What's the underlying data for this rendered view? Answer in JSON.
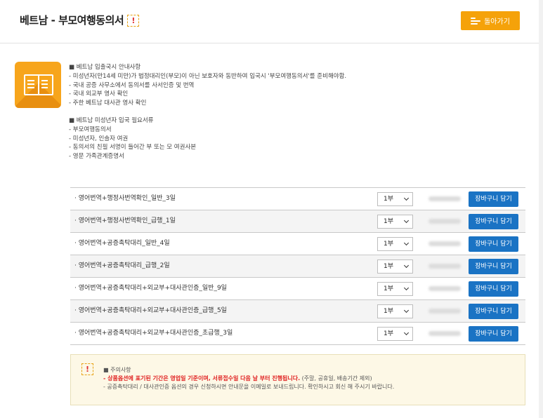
{
  "header": {
    "title": "베트남 - 부모여행동의서",
    "warn_glyph": "!",
    "back_label": "돌아가기"
  },
  "info": {
    "block1": [
      "■ 베트남 입출국시 안내사항",
      "- 미성년자(만14세 미만)가 법정대리인(부모)이 아닌 보호자와 동반하여 입국시 '부모여행동의서'를 준비해야함.",
      "- 국내 공증 사무소에서 동의서를 사서인증 및 번역",
      "- 국내 외교부 영사 확인",
      "- 주한 베트남 대사관 영사 확인"
    ],
    "block2": [
      "■ 베트남 미성년자 입국 필요서류",
      "- 부모여행동의서",
      "- 미성년자, 인솔자 여권",
      "- 동의서의 친필 서명이 들어간 부 또는 모 여권사본",
      "- 영문 가족관계증명서"
    ]
  },
  "products": [
    {
      "name": "·  영어번역+행정사번역확인_일반_3일",
      "qty": "1부",
      "cart": "장바구니 담기"
    },
    {
      "name": "·  영어번역+행정사번역확인_급행_1일",
      "qty": "1부",
      "cart": "장바구니 담기"
    },
    {
      "name": "·  영어번역+공증촉탁대리_일반_4일",
      "qty": "1부",
      "cart": "장바구니 담기"
    },
    {
      "name": "·  영어번역+공증촉탁대리_급행_2일",
      "qty": "1부",
      "cart": "장바구니 담기"
    },
    {
      "name": "·  영어번역+공증촉탁대리+외교부+대사관인증_일반_9일",
      "qty": "1부",
      "cart": "장바구니 담기"
    },
    {
      "name": "·  영어번역+공증촉탁대리+외교부+대사관인증_급행_5일",
      "qty": "1부",
      "cart": "장바구니 담기"
    },
    {
      "name": "·  영어번역+공증촉탁대리+외교부+대사관인증_초급행_3일",
      "qty": "1부",
      "cart": "장바구니 담기"
    }
  ],
  "notice": {
    "title": "■ 주의사항",
    "line1_red": "- 상품옵션에 표기된 기간은 영업일 기준이며, 서류접수일 다음 날 부터 진행됩니다.",
    "line1_rest": " (주말, 공휴일, 배송기간 제외)",
    "line2": "- 공증촉탁대리 / 대사관인증 옵션의 경우 신청하시면 안내문을 이메일로 보내드립니다. 확인하시고 회신 해 주시기 바랍니다."
  },
  "colors": {
    "accent_orange": "#f5a20a",
    "cart_blue": "#1a73c4",
    "notice_bg": "#fdf8e6",
    "warning_red": "#e02020"
  },
  "icons": {
    "back": "list-back-icon",
    "document": "open-book-document-icon",
    "warning": "exclamation-warning-icon",
    "select": "chevron-down-icon"
  }
}
